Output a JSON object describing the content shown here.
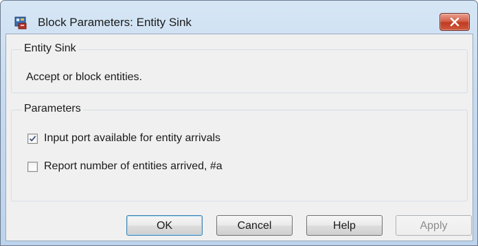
{
  "window": {
    "title": "Block Parameters: Entity Sink",
    "close_glyph": "✕"
  },
  "description_group": {
    "legend": "Entity Sink",
    "text": "Accept or block entities."
  },
  "parameters_group": {
    "legend": "Parameters",
    "options": [
      {
        "label": "Input port available for entity arrivals",
        "checked": true
      },
      {
        "label": "Report number of entities arrived, #a",
        "checked": false
      }
    ]
  },
  "buttons": {
    "ok": "OK",
    "cancel": "Cancel",
    "help": "Help",
    "apply": "Apply"
  },
  "colors": {
    "title_bar": "#c6daf0",
    "close_button": "#c9472f",
    "default_button_border": "#3c7fb1",
    "checkmark": "#3a4f7a"
  },
  "icons": {
    "app": "simulink-block-icon",
    "close": "close-icon",
    "checkmark": "checkmark-icon"
  }
}
